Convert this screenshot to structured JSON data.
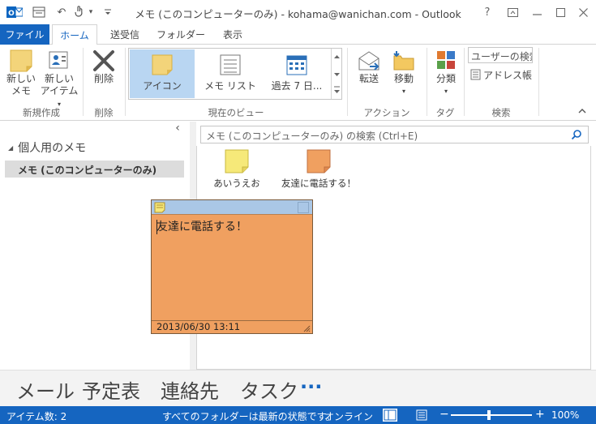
{
  "window": {
    "title": "メモ (このコンピューターのみ) - kohama@wanichan.com - Outlook",
    "help": "?",
    "restore": "⧉",
    "minimize": "—",
    "maximize": "☐",
    "close": "✕"
  },
  "quick_access": {
    "undo_glyph": "↶",
    "dropdown_glyph": "▾",
    "customize_glyph": "₹"
  },
  "tabs": [
    {
      "label": "ファイル"
    },
    {
      "label": "ホーム"
    },
    {
      "label": "送受信"
    },
    {
      "label": "フォルダー"
    },
    {
      "label": "表示"
    }
  ],
  "ribbon": {
    "new_note": {
      "line1": "新しい",
      "line2": "メモ"
    },
    "new_item": {
      "line1": "新しい",
      "line2": "アイテム",
      "caret": "▾"
    },
    "delete": {
      "label": "削除"
    },
    "views": {
      "icon": "アイコン",
      "list": "メモ リスト",
      "last7": "過去 7 日..."
    },
    "forward": "転送",
    "move": {
      "label": "移動",
      "caret": "▾"
    },
    "categorize": {
      "label": "分類",
      "caret": "▾"
    },
    "search_people_placeholder": "ユーザーの検索",
    "address_book": "アドレス帳",
    "groups": {
      "new": "新規作成",
      "delete": "削除",
      "current_view": "現在のビュー",
      "actions": "アクション",
      "tags": "タグ",
      "find": "検索"
    },
    "collapse_glyph": "^"
  },
  "nav": {
    "collapse_glyph": "‹",
    "header": "個人用のメモ",
    "header_caret": "◢",
    "selected_folder": "メモ (このコンピューターのみ)"
  },
  "search": {
    "placeholder": "メモ (このコンピューターのみ) の検索 (Ctrl+E)"
  },
  "notes": [
    {
      "label": "あいうえお",
      "color": "#f6e979"
    },
    {
      "label": "友達に電話する！",
      "color": "#f0a060"
    }
  ],
  "open_note": {
    "body": "友達に電話する！",
    "timestamp": "2013/06/30 13:11",
    "color": "#f0a060"
  },
  "bottom_nav": {
    "mail": "メール",
    "calendar": "予定表",
    "contacts": "連絡先",
    "tasks": "タスク",
    "more": "···"
  },
  "status": {
    "items": "アイテム数: 2",
    "sync": "すべてのフォルダーは最新の状態です。",
    "online": "オンライン",
    "zoom_minus": "−",
    "zoom_plus": "+",
    "zoom": "100%"
  },
  "colors": {
    "accent": "#1565c0",
    "selected_view": "#b9d6f2",
    "selected_folder": "#dcdcdc"
  }
}
